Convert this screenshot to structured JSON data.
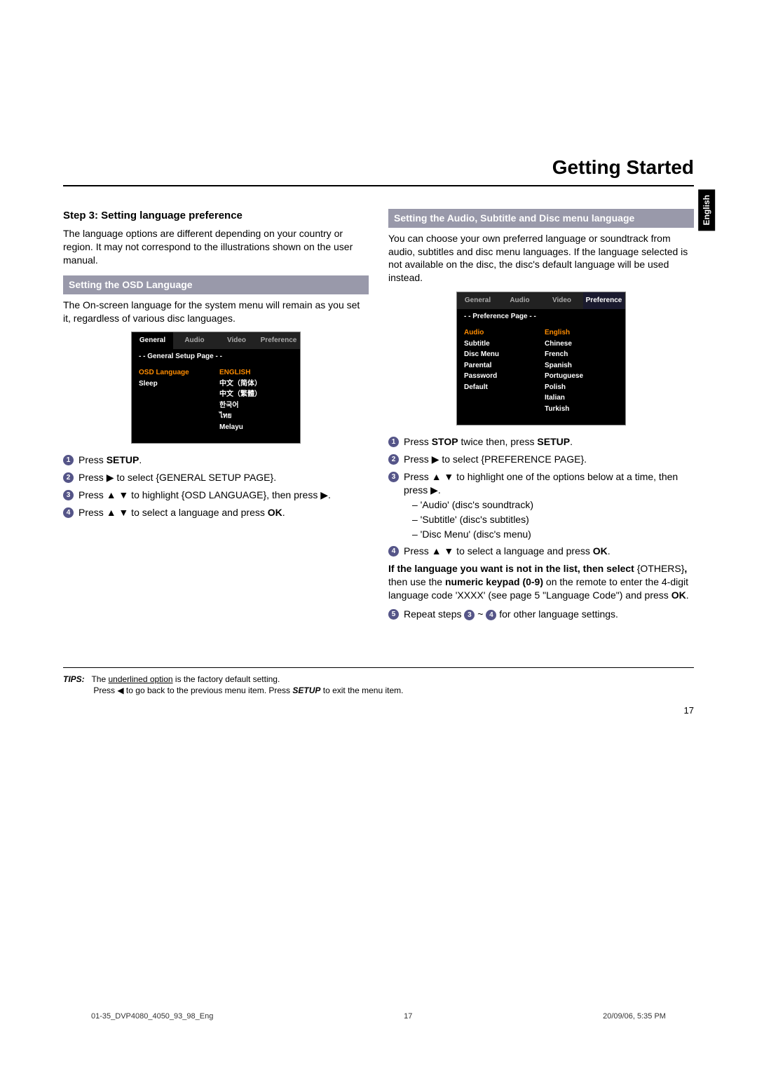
{
  "header_title": "Getting Started",
  "side_tab": "English",
  "left": {
    "step_heading": "Step 3:  Setting language preference",
    "step_intro": "The language options are different depending on your country or region. It may not correspond to the illustrations shown on the user manual.",
    "sub_heading": "Setting the OSD Language",
    "sub_intro": "The On-screen language for the system menu will remain as you set it, regardless of various disc languages.",
    "menu": {
      "tabs": [
        "General",
        "Audio",
        "Video",
        "Preference"
      ],
      "page_label": "- -   General Setup Page   - -",
      "left_items": [
        "OSD Language",
        "Sleep"
      ],
      "right_items": [
        "ENGLISH",
        "中文（简体）",
        "中文（繁體）",
        "한국어",
        "ไทย",
        "Melayu"
      ]
    },
    "s1": "Press ",
    "s1b": "SETUP",
    "s1c": ".",
    "s2a": "Press ",
    "s2b": " to select {GENERAL SETUP PAGE}.",
    "s3a": "Press ",
    "s3b": " to highlight {OSD LANGUAGE}, then press ",
    "s3c": ".",
    "s4a": "Press ",
    "s4b": " to select a language and press ",
    "s4ok": "OK",
    "s4c": "."
  },
  "right": {
    "sub_heading": "Setting the Audio, Subtitle and Disc menu language",
    "intro": "You can choose your own preferred language or soundtrack from audio, subtitles and disc menu languages. If the language selected is not available on the disc, the disc's default language will be used instead.",
    "menu": {
      "tabs": [
        "General",
        "Audio",
        "Video",
        "Preference"
      ],
      "page_label": "- -   Preference Page   - -",
      "left_items": [
        "Audio",
        "Subtitle",
        "Disc Menu",
        "Parental",
        "Password",
        "Default"
      ],
      "right_items": [
        "English",
        "Chinese",
        "French",
        "Spanish",
        "Portuguese",
        "Polish",
        "Italian",
        "Turkish"
      ]
    },
    "s1a": "Press ",
    "s1stop": "STOP",
    "s1b": " twice then, press ",
    "s1setup": "SETUP",
    "s1c": ".",
    "s2a": "Press ",
    "s2b": " to select {PREFERENCE PAGE}.",
    "s3a": "Press ",
    "s3b": " to highlight one of the options below at a time, then press ",
    "s3c": ".",
    "s3_opt1": "–  'Audio' (disc's soundtrack)",
    "s3_opt2": "–  'Subtitle' (disc's subtitles)",
    "s3_opt3": "–  'Disc Menu' (disc's menu)",
    "s4a": "Press ",
    "s4b": " to select a language and press ",
    "s4ok": "OK",
    "s4c": ".",
    "note_bold": "If the language you want is not in the list, then select ",
    "note_others": "{OTHERS}",
    "note_comma": ",",
    "note_rest1": "then use the ",
    "note_kb": "numeric keypad (0-9)",
    "note_rest2": " on the remote to enter the 4-digit language code 'XXXX' (see page 5 \"Language Code\") and press ",
    "note_ok": "OK",
    "note_period": ".",
    "s5a": "Repeat steps ",
    "s5b": " ~ ",
    "s5c": " for other language settings."
  },
  "tips_label": "TIPS:",
  "tips_line1a": "The ",
  "tips_line1u": "underlined option",
  "tips_line1b": " is the factory default setting.",
  "tips_line2a": "Press ",
  "tips_line2b": " to go back to the previous menu item. Press ",
  "tips_setup": "SETUP",
  "tips_line2c": " to exit the menu item.",
  "page_number": "17",
  "footer_file": "01-35_DVP4080_4050_93_98_Eng",
  "footer_page": "17",
  "footer_date": "20/09/06, 5:35 PM"
}
